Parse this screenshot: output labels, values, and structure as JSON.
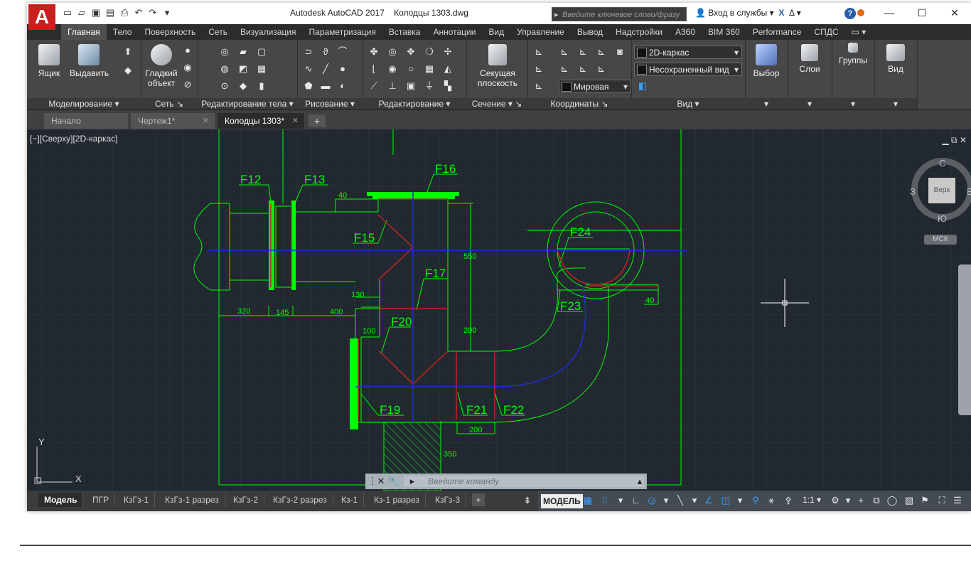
{
  "window": {
    "title": "Autodesk AutoCAD 2017",
    "document": "Колодцы 1303.dwg",
    "search_placeholder": "Введите ключевое слово/фразу",
    "signin": "Вход в службы",
    "help": "?"
  },
  "app_logo": "A",
  "ribbon_tabs": [
    "Главная",
    "Тело",
    "Поверхность",
    "Сеть",
    "Визуализация",
    "Параметризация",
    "Вставка",
    "Аннотации",
    "Вид",
    "Управление",
    "Вывод",
    "Надстройки",
    "A360",
    "BIM 360",
    "Performance",
    "СПДС"
  ],
  "ribbon": {
    "modeling": {
      "title": "Моделирование",
      "box": "Ящик",
      "extrude": "Выдавить"
    },
    "mesh": {
      "title": "Сеть",
      "smooth": "Гладкий объект"
    },
    "solid_edit": {
      "title": "Редактирование тела"
    },
    "draw": {
      "title": "Рисование"
    },
    "modify": {
      "title": "Редактирование"
    },
    "section": {
      "title": "Сечение",
      "plane": "Секущая плоскость"
    },
    "coordinates": {
      "title": "Координаты",
      "ucs": "Мировая"
    },
    "view": {
      "title": "Вид",
      "visual_style": "2D-каркас",
      "named_view": "Несохраненный вид"
    },
    "selection": {
      "label": "Выбор"
    },
    "layers": {
      "label": "Слои"
    },
    "groups": {
      "label": "Группы"
    },
    "view_btn": {
      "label": "Вид"
    }
  },
  "doc_tabs": [
    {
      "label": "Начало"
    },
    {
      "label": "Чертеж1*"
    },
    {
      "label": "Колодцы 1303*"
    }
  ],
  "viewport": {
    "label": "[−][Сверху][2D-каркас]",
    "viewcube": {
      "top": "Верх",
      "north": "С",
      "south": "Ю",
      "west": "З",
      "east": "В",
      "ucs": "МСК"
    }
  },
  "drawing": {
    "labels": [
      "F12",
      "F13",
      "F15",
      "F16",
      "F17",
      "F19",
      "F20",
      "F21",
      "F22",
      "F23",
      "F24"
    ],
    "dims": [
      "40",
      "550",
      "130",
      "320",
      "145",
      "400",
      "100",
      "200",
      "350",
      "200",
      "40"
    ],
    "ucs_x": "X",
    "ucs_y": "Y"
  },
  "command_line": {
    "placeholder": "Введите команду"
  },
  "layout_tabs": [
    "Модель",
    "ПГР",
    "КзГз-1",
    "КзГз-1 разрез",
    "КзГз-2",
    "КзГз-2 разрез",
    "Кз-1",
    "Кз-1 разрез",
    "КзГз-3"
  ],
  "status": {
    "model": "МОДЕЛЬ",
    "scale": "1:1"
  },
  "colors": {
    "green": "#00ff00",
    "red": "#c22222",
    "blue": "#1f2bd6",
    "crosshair": "#ffffff"
  }
}
